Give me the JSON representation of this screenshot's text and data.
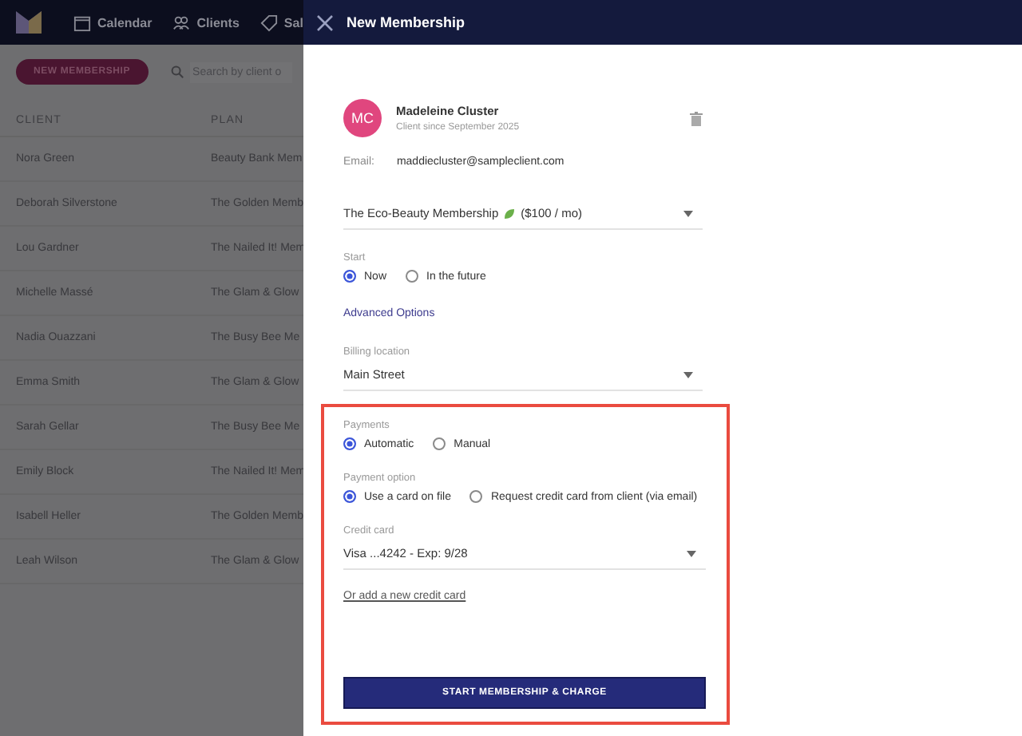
{
  "nav": {
    "items": [
      {
        "label": "Calendar"
      },
      {
        "label": "Clients"
      },
      {
        "label": "Sal"
      }
    ]
  },
  "toolbar": {
    "new_button": "NEW MEMBERSHIP",
    "search": {
      "placeholder": "Search by client o"
    }
  },
  "table": {
    "columns": [
      "CLIENT",
      "PLAN"
    ],
    "rows": [
      [
        "Nora Green",
        "Beauty Bank Mem"
      ],
      [
        "Deborah Silverstone",
        "The Golden Memb"
      ],
      [
        "Lou Gardner",
        "The Nailed It! Mem"
      ],
      [
        "Michelle Massé",
        "The Glam & Glow"
      ],
      [
        "Nadia Ouazzani",
        "The Busy Bee Me"
      ],
      [
        "Emma Smith",
        "The Glam & Glow"
      ],
      [
        "Sarah Gellar",
        "The Busy Bee Me"
      ],
      [
        "Emily Block",
        "The Nailed It! Mem"
      ],
      [
        "Isabell Heller",
        "The Golden Memb"
      ],
      [
        "Leah Wilson",
        "The Glam & Glow"
      ]
    ]
  },
  "panel": {
    "title": "New Membership",
    "client": {
      "initials": "MC",
      "name": "Madeleine Cluster",
      "since": "Client since September 2025"
    },
    "email": {
      "label": "Email:",
      "value": "maddiecluster@sampleclient.com"
    },
    "fields": [
      {
        "kind": "dropdown",
        "value": "The Eco-Beauty Membership",
        "suffix": "($100 / mo)"
      },
      {
        "kind": "radio",
        "label": "Start",
        "options": [
          {
            "label": "Now",
            "selected": true
          },
          {
            "label": "In the future",
            "selected": false
          }
        ]
      },
      {
        "kind": "link",
        "label": "Advanced Options"
      },
      {
        "kind": "dropdown",
        "label": "Billing location",
        "value": "Main Street"
      }
    ],
    "highlighted_fields": [
      {
        "kind": "radio",
        "label": "Payments",
        "options": [
          {
            "label": "Automatic",
            "selected": true
          },
          {
            "label": "Manual",
            "selected": false
          }
        ]
      },
      {
        "kind": "radio",
        "label": "Payment option",
        "options": [
          {
            "label": "Use a card on file",
            "selected": true
          },
          {
            "label": "Request credit card from client (via email)",
            "selected": false
          }
        ]
      },
      {
        "kind": "dropdown",
        "label": "Credit card",
        "value": "Visa ...4242 - Exp: 9/28"
      },
      {
        "kind": "underline_link",
        "label": "Or add a new credit card"
      }
    ],
    "submit_button": "START MEMBERSHIP & CHARGE"
  }
}
